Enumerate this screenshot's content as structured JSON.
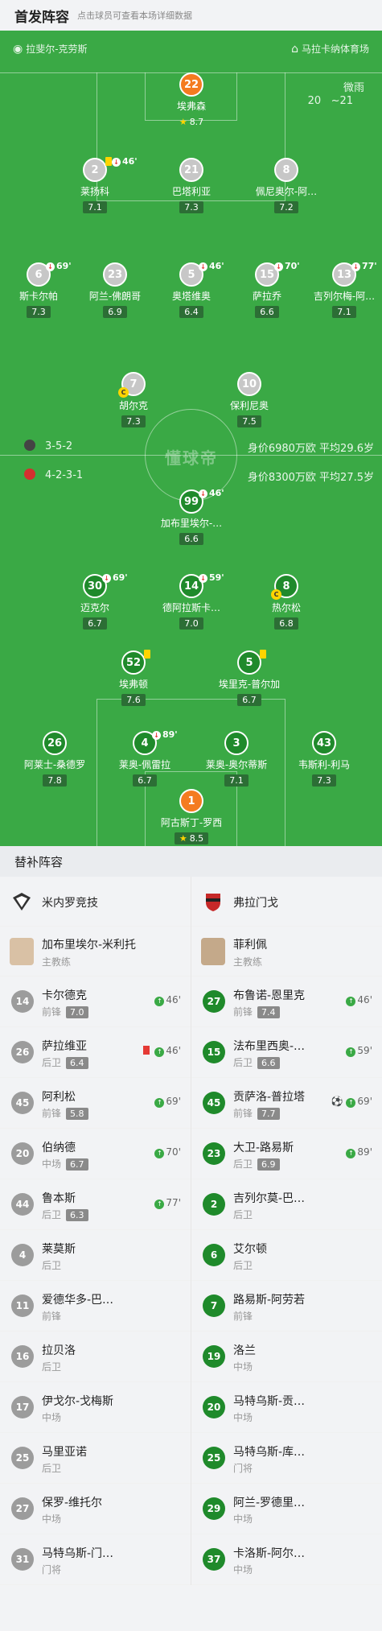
{
  "header": {
    "title": "首发阵容",
    "subtitle": "点击球员可查看本场详细数据"
  },
  "pitch": {
    "home_coach_label": "拉斐尔-克劳斯",
    "stadium": "马拉卡纳体育场",
    "weather": "微雨",
    "temp_low": "20",
    "temp_high": "~21",
    "watermark": "懂球帝",
    "away_formation": "3-5-2",
    "away_value": "身价6980万欧  平均29.6岁",
    "home_formation": "4-2-3-1",
    "home_value": "身价8300万欧  平均27.5岁"
  },
  "away_players": [
    {
      "num": "22",
      "name": "埃弗森",
      "rating": "8.7",
      "gk": true
    },
    {
      "num": "2",
      "name": "莱扬科",
      "rating": "7.1",
      "sub": "46'",
      "yc": true
    },
    {
      "num": "21",
      "name": "巴塔利亚",
      "rating": "7.3"
    },
    {
      "num": "8",
      "name": "佩尼奥尔-阿…",
      "rating": "7.2"
    },
    {
      "num": "6",
      "name": "斯卡尔帕",
      "rating": "7.3",
      "sub": "69'"
    },
    {
      "num": "23",
      "name": "阿兰-佛朗哥",
      "rating": "6.9"
    },
    {
      "num": "5",
      "name": "奥塔维奥",
      "rating": "6.4",
      "sub": "46'"
    },
    {
      "num": "15",
      "name": "萨拉乔",
      "rating": "6.6",
      "sub": "70'"
    },
    {
      "num": "13",
      "name": "吉列尔梅-阿…",
      "rating": "7.1",
      "sub": "77'"
    },
    {
      "num": "7",
      "name": "胡尔克",
      "rating": "7.3",
      "cap": "C"
    },
    {
      "num": "10",
      "name": "保利尼奥",
      "rating": "7.5"
    }
  ],
  "home_players": [
    {
      "num": "99",
      "name": "加布里埃尔-…",
      "rating": "6.6",
      "sub": "46'"
    },
    {
      "num": "30",
      "name": "迈克尔",
      "rating": "6.7",
      "sub": "69'"
    },
    {
      "num": "14",
      "name": "德阿拉斯卡…",
      "rating": "7.0",
      "sub": "59'"
    },
    {
      "num": "8",
      "name": "热尔松",
      "rating": "6.8",
      "cap": "C"
    },
    {
      "num": "52",
      "name": "埃弗顿",
      "rating": "7.6",
      "yc": true
    },
    {
      "num": "5",
      "name": "埃里克-普尔加",
      "rating": "6.7",
      "yc": true
    },
    {
      "num": "26",
      "name": "阿莱士-桑德罗",
      "rating": "7.8"
    },
    {
      "num": "4",
      "name": "莱奥-佩雷拉",
      "rating": "6.7",
      "sub": "89'"
    },
    {
      "num": "3",
      "name": "莱奥-奥尔蒂斯",
      "rating": "7.1"
    },
    {
      "num": "43",
      "name": "韦斯利-利马",
      "rating": "7.3"
    },
    {
      "num": "1",
      "name": "阿古斯丁-罗西",
      "rating": "8.5",
      "gk": true
    }
  ],
  "subs": {
    "section_title": "替补阵容",
    "left_team": "米内罗竞技",
    "right_team": "弗拉门戈",
    "left_coach": {
      "name": "加布里埃尔-米利托",
      "role": "主教练"
    },
    "right_coach": {
      "name": "菲利佩",
      "role": "主教练"
    },
    "left": [
      {
        "num": "14",
        "name": "卡尔德克",
        "pos": "前锋",
        "score": "7.0",
        "ev": "46'"
      },
      {
        "num": "26",
        "name": "萨拉维亚",
        "pos": "后卫",
        "score": "6.4",
        "ev": "46'",
        "rc": true
      },
      {
        "num": "45",
        "name": "阿利松",
        "pos": "前锋",
        "score": "5.8",
        "ev": "69'"
      },
      {
        "num": "20",
        "name": "伯纳德",
        "pos": "中场",
        "score": "6.7",
        "ev": "70'"
      },
      {
        "num": "44",
        "name": "鲁本斯",
        "pos": "后卫",
        "score": "6.3",
        "ev": "77'"
      },
      {
        "num": "4",
        "name": "莱莫斯",
        "pos": "后卫"
      },
      {
        "num": "11",
        "name": "爱德华多-巴…",
        "pos": "前锋"
      },
      {
        "num": "16",
        "name": "拉贝洛",
        "pos": "后卫"
      },
      {
        "num": "17",
        "name": "伊戈尔-戈梅斯",
        "pos": "中场"
      },
      {
        "num": "25",
        "name": "马里亚诺",
        "pos": "后卫"
      },
      {
        "num": "27",
        "name": "保罗-维托尔",
        "pos": "中场"
      },
      {
        "num": "31",
        "name": "马特乌斯-门…",
        "pos": "门将"
      }
    ],
    "right": [
      {
        "num": "27",
        "name": "布鲁诺-恩里克",
        "pos": "前锋",
        "score": "7.4",
        "ev": "46'"
      },
      {
        "num": "15",
        "name": "法布里西奥-…",
        "pos": "后卫",
        "score": "6.6",
        "ev": "59'"
      },
      {
        "num": "45",
        "name": "贡萨洛-普拉塔",
        "pos": "前锋",
        "score": "7.7",
        "ev": "69'",
        "goal": true
      },
      {
        "num": "23",
        "name": "大卫-路易斯",
        "pos": "后卫",
        "score": "6.9",
        "ev": "89'"
      },
      {
        "num": "2",
        "name": "吉列尔莫-巴…",
        "pos": "后卫"
      },
      {
        "num": "6",
        "name": "艾尔顿",
        "pos": "后卫"
      },
      {
        "num": "7",
        "name": "路易斯-阿劳若",
        "pos": "前锋"
      },
      {
        "num": "19",
        "name": "洛兰",
        "pos": "中场"
      },
      {
        "num": "20",
        "name": "马特乌斯-贡…",
        "pos": "中场"
      },
      {
        "num": "25",
        "name": "马特乌斯-库…",
        "pos": "门将"
      },
      {
        "num": "29",
        "name": "阿兰-罗德里…",
        "pos": "中场"
      },
      {
        "num": "37",
        "name": "卡洛斯-阿尔…",
        "pos": "中场"
      }
    ]
  }
}
